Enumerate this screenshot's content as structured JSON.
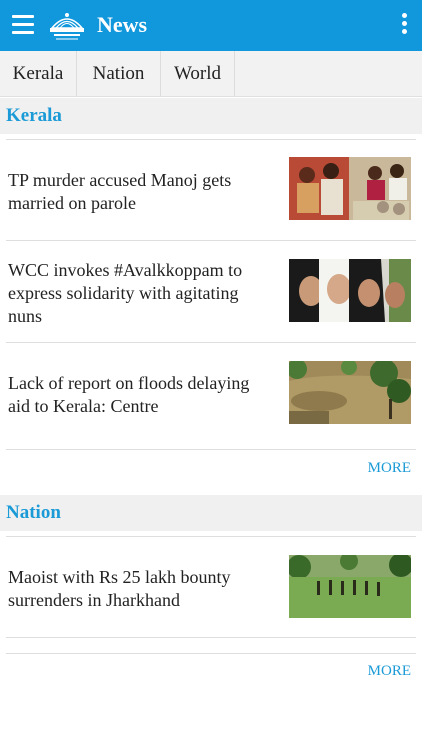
{
  "header": {
    "title": "News",
    "menu_icon": "hamburger-menu-icon",
    "logo_icon": "newspaper-crest-logo",
    "overflow_icon": "more-vertical-icon",
    "accent_color": "#1197dc"
  },
  "tabs": [
    {
      "label": "Kerala"
    },
    {
      "label": "Nation"
    },
    {
      "label": "World"
    }
  ],
  "sections": [
    {
      "title": "Kerala",
      "articles": [
        {
          "headline": "TP murder accused Manoj gets married on parole",
          "thumbnail": "wedding-photo"
        },
        {
          "headline": "WCC invokes #Avalkkoppam to express solidarity with agitating nuns",
          "thumbnail": "nuns-photo"
        },
        {
          "headline": "Lack of report on floods delaying aid to Kerala: Centre",
          "thumbnail": "flood-photo"
        }
      ],
      "more_label": "MORE"
    },
    {
      "title": "Nation",
      "articles": [
        {
          "headline": "Maoist with Rs 25 lakh bounty surrenders in Jharkhand",
          "thumbnail": "field-patrol-photo"
        }
      ],
      "more_label": "MORE"
    }
  ]
}
